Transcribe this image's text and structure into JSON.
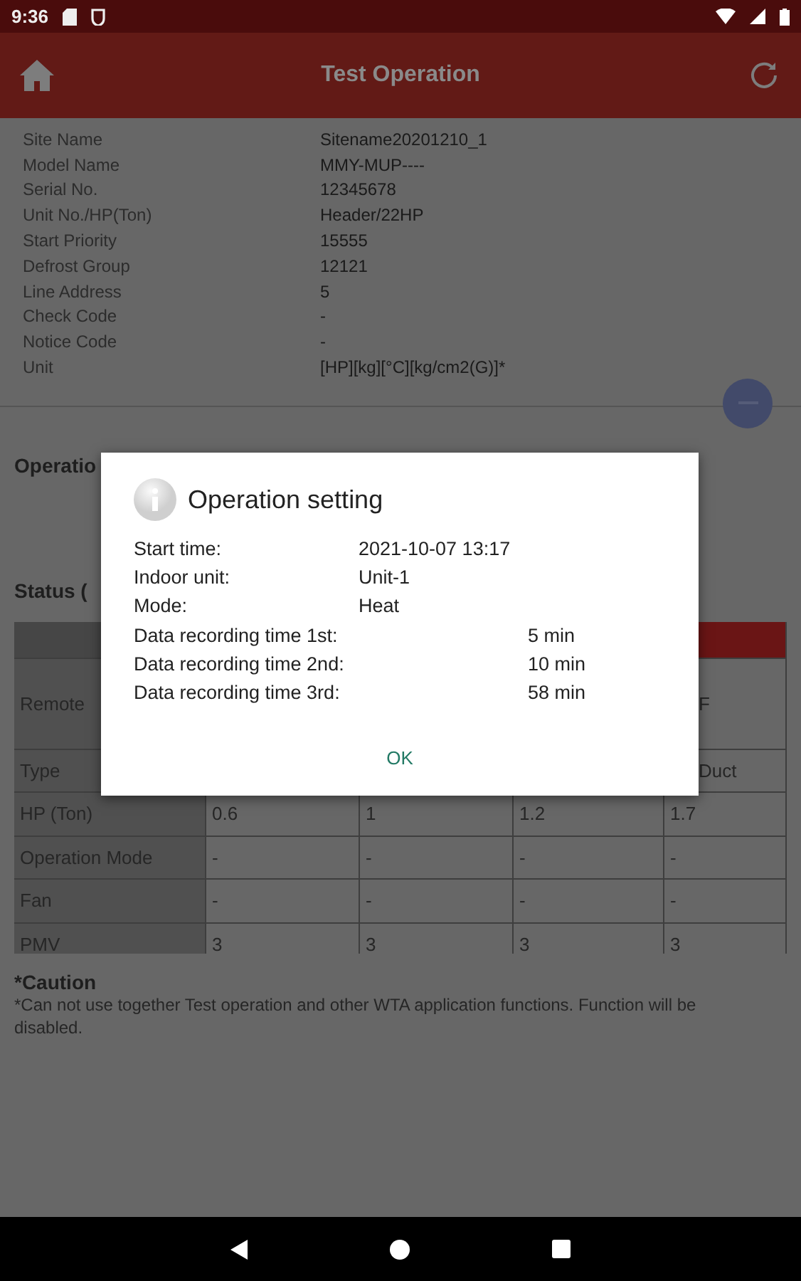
{
  "status_bar": {
    "time": "9:36"
  },
  "app_bar": {
    "title": "Test Operation"
  },
  "info": [
    {
      "label": "Site Name",
      "value": "Sitename20201210_1"
    },
    {
      "label": "Model Name",
      "value": "MMY-MUP----"
    },
    {
      "label": "Serial No.",
      "value": "12345678"
    },
    {
      "label": "Unit No./HP(Ton)",
      "value": "Header/22HP"
    },
    {
      "label": "Start Priority",
      "value": "15555"
    },
    {
      "label": "Defrost Group",
      "value": "12121"
    },
    {
      "label": "Line Address",
      "value": "5"
    },
    {
      "label": "Check Code",
      "value": "-"
    },
    {
      "label": "Notice Code",
      "value": "-"
    },
    {
      "label": "Unit",
      "value": "[HP][kg][°C][kg/cm2(G)]*"
    }
  ],
  "operation_heading": "Operatio",
  "status_heading": "Status (",
  "table": {
    "rows": [
      [
        "",
        "",
        "",
        "",
        ""
      ],
      [
        "Remote",
        "",
        "",
        "",
        "F"
      ],
      [
        "Type",
        "",
        "",
        "",
        "Duct"
      ],
      [
        "HP (Ton)",
        "0.6",
        "1",
        "1.2",
        "1.7"
      ],
      [
        "Operation Mode",
        "-",
        "-",
        "-",
        "-"
      ],
      [
        "Fan",
        "-",
        "-",
        "-",
        "-"
      ],
      [
        "PMV",
        "3",
        "3",
        "3",
        "3"
      ]
    ]
  },
  "caution": {
    "title": "*Caution",
    "text": "*Can not use together Test operation and other WTA application functions. Function will be disabled."
  },
  "dialog": {
    "title": "Operation setting",
    "fields": [
      {
        "kind": "info",
        "label": "Start time:",
        "value": "2021-10-07 13:17"
      },
      {
        "kind": "info",
        "label": "Indoor unit:",
        "value": "Unit-1"
      },
      {
        "kind": "info",
        "label": "Mode:",
        "value": "Heat"
      },
      {
        "kind": "recording",
        "label": "Data recording time 1st:",
        "value": "5 min"
      },
      {
        "kind": "recording",
        "label": "Data recording time 2nd:",
        "value": "10 min"
      },
      {
        "kind": "recording",
        "label": "Data recording time 3rd:",
        "value": "58 min"
      }
    ],
    "button": "OK"
  }
}
